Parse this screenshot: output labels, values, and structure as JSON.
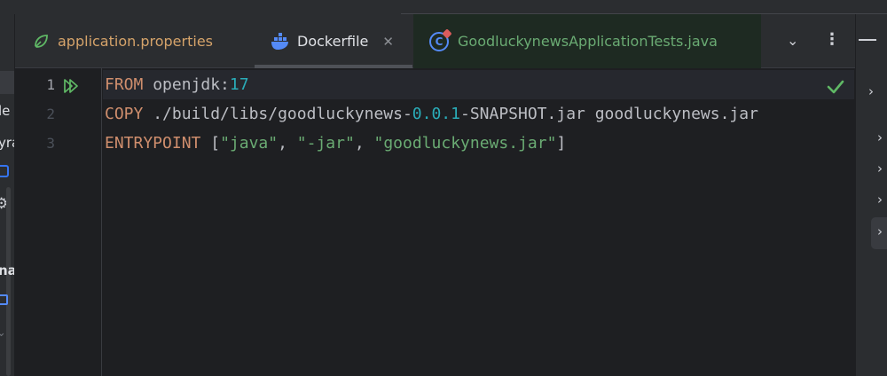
{
  "tabs": [
    {
      "label": "application.properties",
      "icon": "spring-leaf-icon",
      "active": false
    },
    {
      "label": "Dockerfile",
      "icon": "docker-icon",
      "active": true,
      "close_glyph": "✕"
    },
    {
      "label": "GoodluckynewsApplicationTests.java",
      "icon": "java-class-icon",
      "active": false,
      "icon_letter": "C"
    }
  ],
  "tabbar": {
    "more_glyph": "⌄",
    "menu_glyph": "⋮"
  },
  "left_pane": {
    "fragments": [
      "le",
      "yra",
      "na"
    ]
  },
  "gutter": {
    "line_numbers": [
      "1",
      "2",
      "3"
    ]
  },
  "editor": {
    "lines": [
      [
        {
          "t": "FROM",
          "c": "kw"
        },
        {
          "t": " openjdk:",
          "c": "plain"
        },
        {
          "t": "17",
          "c": "num"
        }
      ],
      [
        {
          "t": "COPY",
          "c": "kw"
        },
        {
          "t": " ./build/libs/goodluckynews-",
          "c": "plain"
        },
        {
          "t": "0.0.1",
          "c": "num"
        },
        {
          "t": "-SNAPSHOT.jar goodluckynews.jar",
          "c": "plain"
        }
      ],
      [
        {
          "t": "ENTRYPOINT",
          "c": "kw"
        },
        {
          "t": " [",
          "c": "plain"
        },
        {
          "t": "\"java\"",
          "c": "str"
        },
        {
          "t": ", ",
          "c": "plain"
        },
        {
          "t": "\"-jar\"",
          "c": "str"
        },
        {
          "t": ", ",
          "c": "plain"
        },
        {
          "t": "\"goodluckynews.jar\"",
          "c": "str"
        },
        {
          "t": "]",
          "c": "plain"
        }
      ]
    ],
    "status": "no-problems"
  },
  "colors": {
    "keyword": "#cf8e6d",
    "number": "#2aacb8",
    "string": "#6aab73",
    "text": "#bcbec4",
    "background": "#1e1f22"
  }
}
